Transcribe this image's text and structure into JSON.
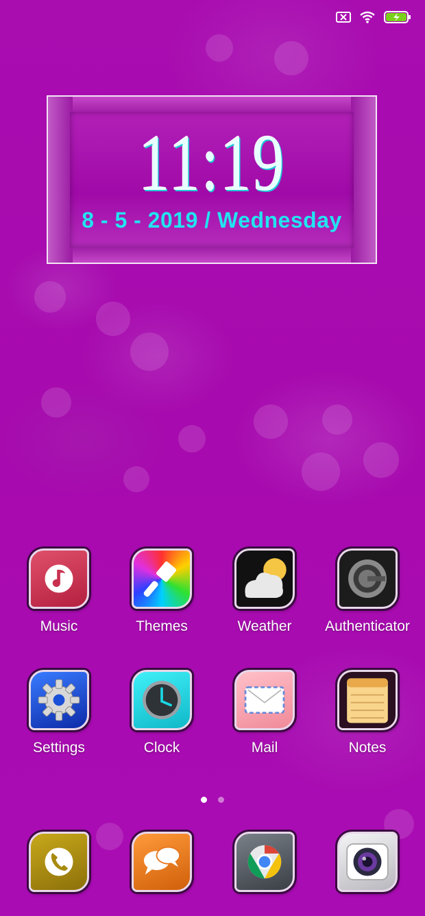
{
  "status_bar": {
    "icons": [
      "sim-missing-icon",
      "wifi-icon",
      "battery-charging-icon"
    ],
    "battery_color": "#7ad11b"
  },
  "clock_widget": {
    "time": "11:19",
    "date": "8 - 5 - 2019  /  Wednesday",
    "time_color": "#e8ffff",
    "date_color": "#22e4f0"
  },
  "apps": {
    "row1": [
      {
        "label": "Music",
        "icon": "music-note-icon",
        "color": "#c8304f"
      },
      {
        "label": "Themes",
        "icon": "paintbrush-icon",
        "color": "#rainbow"
      },
      {
        "label": "Weather",
        "icon": "weather-cloud-sun-icon",
        "color": "#111111"
      },
      {
        "label": "Authenticator",
        "icon": "authenticator-icon",
        "color": "#222222"
      }
    ],
    "row2": [
      {
        "label": "Settings",
        "icon": "gear-icon",
        "color": "#1a4fd8"
      },
      {
        "label": "Clock",
        "icon": "clock-icon",
        "color": "#19d6e0"
      },
      {
        "label": "Mail",
        "icon": "envelope-icon",
        "color": "#f5a4b0"
      },
      {
        "label": "Notes",
        "icon": "notepad-icon",
        "color": "#2a1020"
      }
    ],
    "dock": [
      {
        "icon": "phone-icon",
        "color": "#a88a0e"
      },
      {
        "icon": "messages-icon",
        "color": "#e8781f"
      },
      {
        "icon": "chrome-icon",
        "color": "#5a5f66"
      },
      {
        "icon": "camera-icon",
        "color": "#d8d8dc"
      }
    ]
  },
  "page_indicator": {
    "pages": 2,
    "current": 1
  },
  "colors": {
    "wallpaper": "#a90db0"
  }
}
